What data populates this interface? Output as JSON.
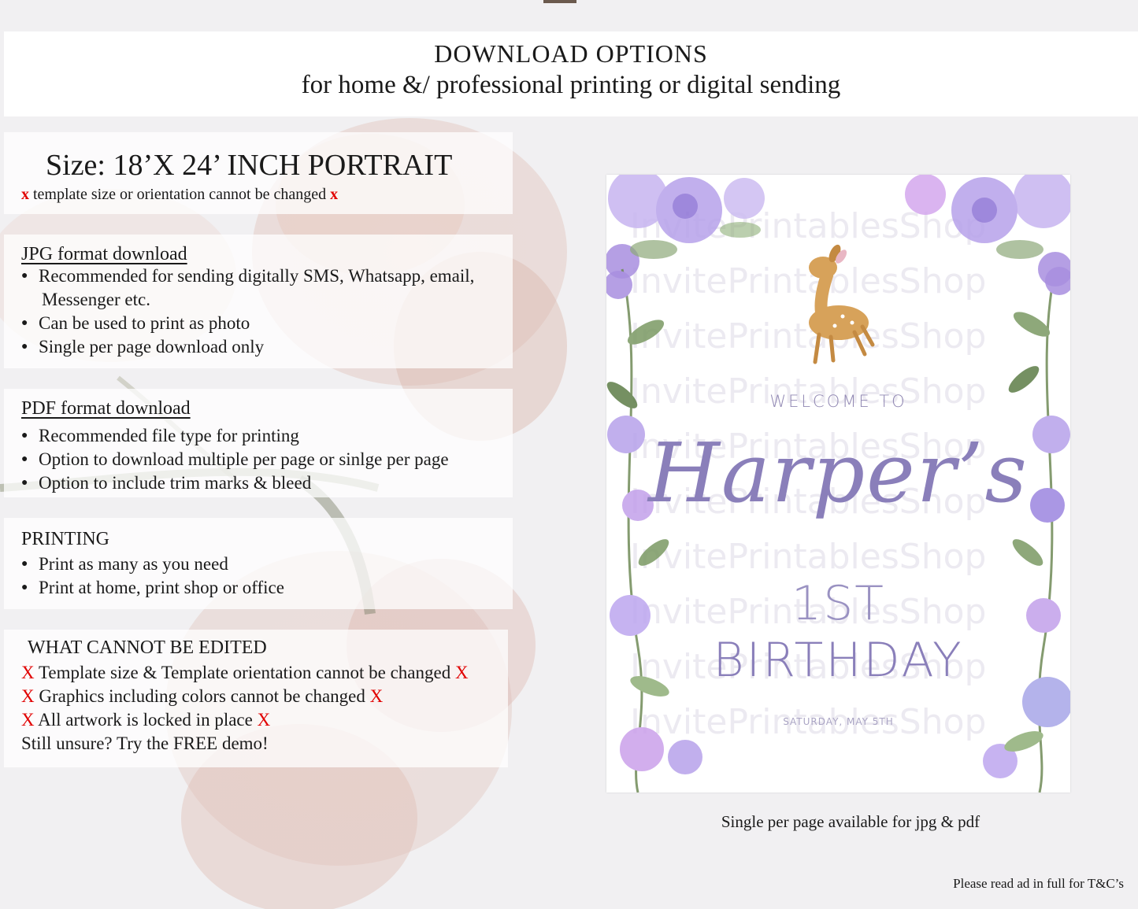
{
  "header": {
    "title": "DOWNLOAD OPTIONS",
    "subtitle": "for home &/ professional printing or digital sending"
  },
  "size": {
    "title": "Size: 18’X 24’ INCH PORTRAIT",
    "note": "template size or orientation cannot be changed",
    "x_mark": "x"
  },
  "jpg": {
    "heading": "JPG format download",
    "items": [
      "Recommended for sending digitally SMS, Whatsapp, email,",
      "Messenger etc.",
      "Can be used to print as photo",
      "Single per page download only"
    ]
  },
  "pdf": {
    "heading": "PDF format download",
    "items": [
      "Recommended file type for printing",
      "Option to download multiple per page or sinlge per page",
      "Option to include trim marks & bleed"
    ]
  },
  "printing": {
    "heading": "PRINTING",
    "items": [
      "Print as many as you need",
      "Print at home, print shop or office"
    ]
  },
  "cannot_edit": {
    "heading": "WHAT CANNOT BE EDITED",
    "x_mark": "X",
    "items": [
      "Template size & Template orientation cannot be changed",
      "Graphics including colors cannot be changed",
      "All artwork is locked in place"
    ],
    "closing": "Still unsure? Try the FREE demo!"
  },
  "poster": {
    "welcome": "WELCOME TO",
    "name": "Harper’s",
    "first": "1ST",
    "birthday": "BIRTHDAY",
    "date": "SATURDAY, MAY 5TH",
    "watermark": "InvitePrintablesShop",
    "colors": {
      "text": "#8a7fba",
      "flower": "#a98fe0",
      "leaf": "#7b9a63"
    },
    "illustration_icons": [
      "fawn-illustration",
      "floral-border"
    ]
  },
  "caption": "Single per page available for jpg & pdf",
  "footer": "Please read ad in full for T&C’s"
}
